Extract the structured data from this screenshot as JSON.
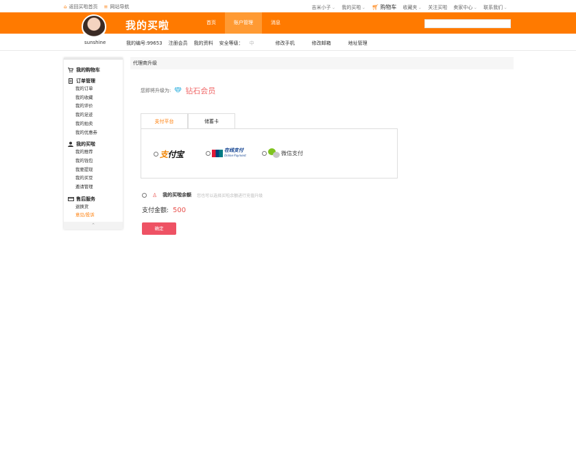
{
  "topbar": {
    "home_link": "返回买啦首页",
    "site_nav": "网站导航",
    "user_name": "吉米小子",
    "my_account": "我的买啦",
    "cart": "购物车",
    "favorites": "收藏夹",
    "follow": "关注买啦",
    "seller_center": "卖家中心",
    "contact": "联系我们"
  },
  "header": {
    "brand": "我的买啦",
    "nav": [
      "首页",
      "账户管理",
      "消息"
    ],
    "active_nav": "账户管理"
  },
  "subnav": {
    "username": "sunshine",
    "member_id": "我的编号:99653",
    "links": [
      "注册会员",
      "我的资料"
    ],
    "security_label": "安全等级：",
    "security_value": "中",
    "actions": [
      "修改手机",
      "修改邮箱",
      "地址管理"
    ]
  },
  "sidebar": {
    "cart_title": "我的购物车",
    "orders_title": "订单管理",
    "orders": [
      "我的订单",
      "我的收藏",
      "我的评价",
      "我的足迹",
      "我的拍卖",
      "我的优惠券"
    ],
    "mine_title": "我的买啦",
    "mine": [
      "我的推荐",
      "我的钱包",
      "我要提现",
      "我的买豆",
      "邀请管理"
    ],
    "service_title": "售后服务",
    "service": [
      "退换货",
      "意见/投诉"
    ],
    "collapse": "⌃"
  },
  "main": {
    "breadcrumb": "代理商升级",
    "upgrade_label": "您即将升级为:",
    "upgrade_level": "钻石会员",
    "tabs": [
      "支付平台",
      "储蓄卡"
    ],
    "active_tab": "支付平台",
    "pay_options": [
      {
        "name": "支付宝",
        "icon": "alipay-icon"
      },
      {
        "name": "在线支付",
        "sub": "Online Payment",
        "icon": "unionpay-icon"
      },
      {
        "name": "微信支付",
        "icon": "wechat-icon"
      }
    ],
    "balance_label": "我的买啦余额",
    "balance_hint": "您也可以选择买啦余额进行充值升级",
    "amount_label": "支付金额:",
    "amount_value": "500",
    "confirm": "确定"
  },
  "colors": {
    "brand_orange": "#ff7a00",
    "confirm_red": "#ee5264",
    "accent_red": "#e8504c"
  }
}
